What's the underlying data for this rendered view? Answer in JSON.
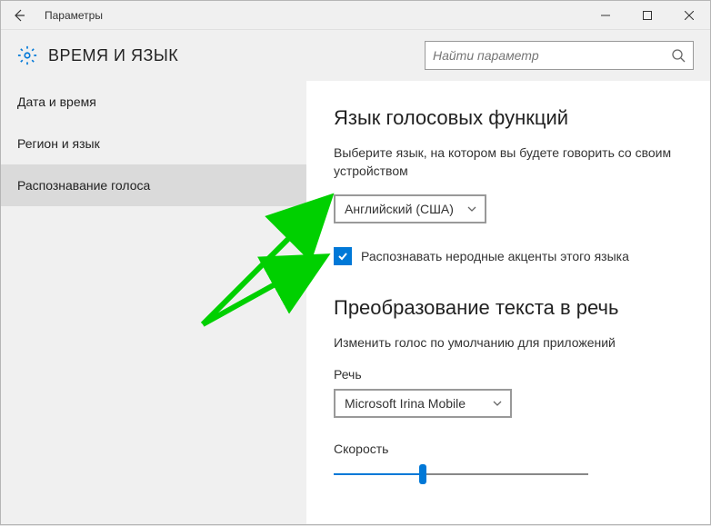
{
  "titlebar": {
    "title": "Параметры"
  },
  "header": {
    "title": "ВРЕМЯ И ЯЗЫК",
    "search_placeholder": "Найти параметр"
  },
  "sidebar": {
    "items": [
      {
        "label": "Дата и время"
      },
      {
        "label": "Регион и язык"
      },
      {
        "label": "Распознавание голоса"
      }
    ]
  },
  "main": {
    "section1_title": "Язык голосовых функций",
    "section1_desc": "Выберите язык, на котором вы будете говорить со своим устройством",
    "language_select": "Английский (США)",
    "checkbox_label": "Распознавать неродные акценты этого языка",
    "section2_title": "Преобразование текста в речь",
    "section2_desc": "Изменить голос по умолчанию для приложений",
    "voice_label": "Речь",
    "voice_select": "Microsoft Irina Mobile",
    "speed_label": "Скорость"
  }
}
